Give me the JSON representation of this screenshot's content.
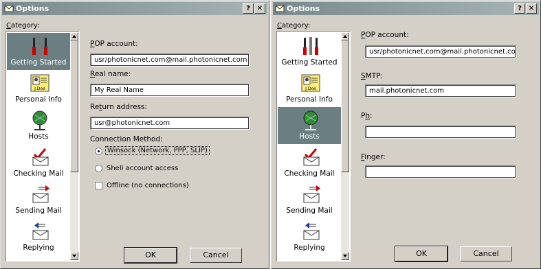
{
  "window_left": {
    "title": "Options",
    "help_label": "?",
    "close_label": "✕",
    "category_label": "Category:",
    "categories": [
      {
        "label": "Getting Started",
        "icon": "tools-icon",
        "selected": true
      },
      {
        "label": "Personal Info",
        "icon": "id-card-icon",
        "selected": false
      },
      {
        "label": "Hosts",
        "icon": "globe-network-icon",
        "selected": false
      },
      {
        "label": "Checking Mail",
        "icon": "checking-mail-icon",
        "selected": false
      },
      {
        "label": "Sending Mail",
        "icon": "sending-mail-icon",
        "selected": false
      },
      {
        "label": "Replying",
        "icon": "replying-icon",
        "selected": false
      }
    ],
    "pop_label": "POP account:",
    "pop_value": "usr/photonicnet.com@mail.photonicnet.com",
    "real_name_label": "Real name:",
    "real_name_value": "My Real Name",
    "return_label": "Return address:",
    "return_value": "usr@photonicnet.com",
    "connection_label": "Connection Method:",
    "options": [
      {
        "label": "Winsock (Network, PPP, SLIP)",
        "selected": true
      },
      {
        "label": "Shell account access",
        "selected": false
      }
    ],
    "offline_label": "Offline (no connections)",
    "offline_checked": false,
    "ok_label": "OK",
    "cancel_label": "Cancel"
  },
  "window_right": {
    "title": "Options",
    "help_label": "?",
    "close_label": "✕",
    "category_label": "Category:",
    "categories": [
      {
        "label": "Getting Started",
        "icon": "tools-icon",
        "selected": false
      },
      {
        "label": "Personal Info",
        "icon": "id-card-icon",
        "selected": false
      },
      {
        "label": "Hosts",
        "icon": "globe-network-icon",
        "selected": true
      },
      {
        "label": "Checking Mail",
        "icon": "checking-mail-icon",
        "selected": false
      },
      {
        "label": "Sending Mail",
        "icon": "sending-mail-icon",
        "selected": false
      },
      {
        "label": "Replying",
        "icon": "replying-icon",
        "selected": false
      }
    ],
    "pop_label": "POP account:",
    "pop_value": "usr/photonicnet.com@mail.photonicnet.com",
    "smtp_label": "SMTP:",
    "smtp_value": "mail.photonicnet.com",
    "ph_label": "Ph:",
    "ph_value": "",
    "finger_label": "Finger:",
    "finger_value": "",
    "ok_label": "OK",
    "cancel_label": "Cancel"
  },
  "colors": {
    "face": "#d4d0c8",
    "selection": "#6b7f83",
    "titlebar_start": "#7a8a8c"
  }
}
